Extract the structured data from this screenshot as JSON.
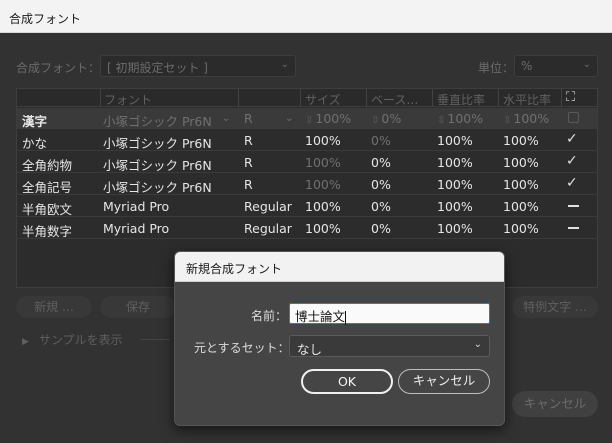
{
  "window": {
    "title": "合成フォント"
  },
  "toolbar": {
    "composite_font_label": "合成フォント：",
    "composite_font_value": "[ 初期設定セット ]",
    "unit_label": "単位：",
    "unit_value": "%"
  },
  "table": {
    "headers": [
      "フォント",
      "サイズ",
      "ベース…",
      "垂直比率",
      "水平比率"
    ],
    "rows": [
      {
        "name": "漢字",
        "font": "小塚ゴシック Pr6N",
        "style": "R",
        "size": "100%",
        "base": "0%",
        "vscale": "100%",
        "hscale": "100%",
        "flag": "checkbox"
      },
      {
        "name": "かな",
        "font": "小塚ゴシック Pr6N",
        "style": "R",
        "size": "100%",
        "base": "0%",
        "vscale": "100%",
        "hscale": "100%",
        "flag": "check"
      },
      {
        "name": "全角約物",
        "font": "小塚ゴシック Pr6N",
        "style": "R",
        "size": "100%",
        "base": "0%",
        "vscale": "100%",
        "hscale": "100%",
        "flag": "check"
      },
      {
        "name": "全角記号",
        "font": "小塚ゴシック Pr6N",
        "style": "R",
        "size": "100%",
        "base": "0%",
        "vscale": "100%",
        "hscale": "100%",
        "flag": "check"
      },
      {
        "name": "半角欧文",
        "font": "Myriad Pro",
        "style": "Regular",
        "size": "100%",
        "base": "0%",
        "vscale": "100%",
        "hscale": "100%",
        "flag": "dash"
      },
      {
        "name": "半角数字",
        "font": "Myriad Pro",
        "style": "Regular",
        "size": "100%",
        "base": "0%",
        "vscale": "100%",
        "hscale": "100%",
        "flag": "dash"
      }
    ]
  },
  "buttons": {
    "new": "新規 …",
    "save": "保存",
    "exceptions": "特例文字 …",
    "cancel_bg": "キャンセル"
  },
  "sample": {
    "label": "サンプルを表示"
  },
  "dialog": {
    "title": "新規合成フォント",
    "name_label": "名前：",
    "name_value": "博士論文",
    "base_set_label": "元とするセット：",
    "base_set_value": "なし",
    "ok": "OK",
    "cancel": "キャンセル"
  },
  "colors": {
    "dialog_bg": "#454545",
    "main_bg": "#323232",
    "focus_border": "#2d7ad6"
  }
}
